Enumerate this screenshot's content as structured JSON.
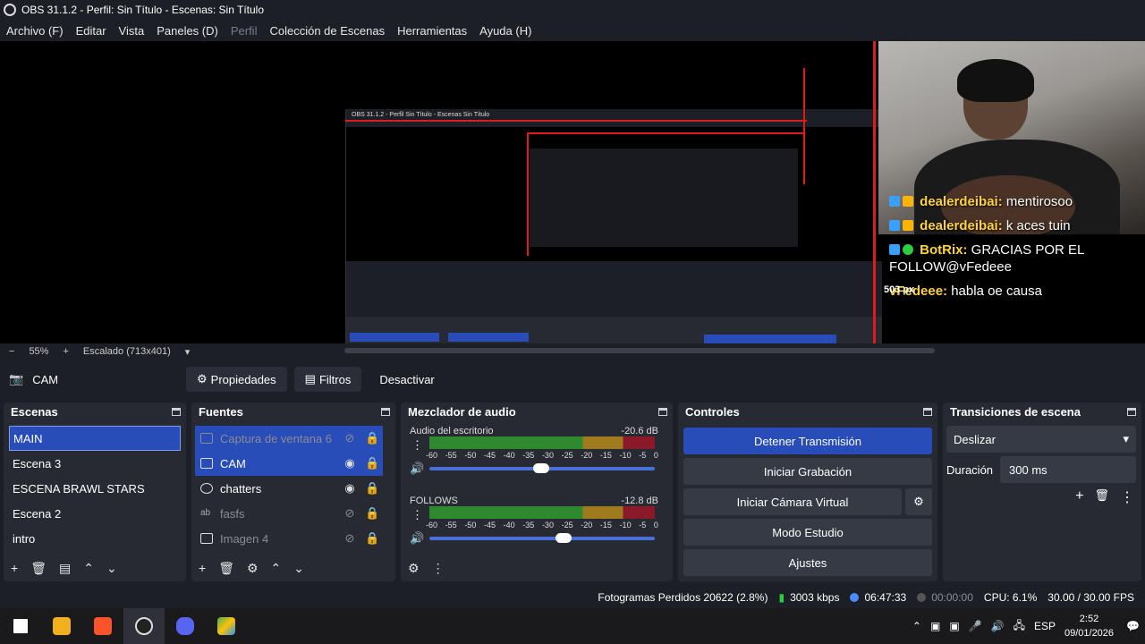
{
  "window": {
    "title": "OBS 31.1.2 - Perfil: Sin Título - Escenas: Sin Título"
  },
  "menu": {
    "items": [
      "Archivo (F)",
      "Editar",
      "Vista",
      "Paneles (D)",
      "Perfil",
      "Colección de Escenas",
      "Herramientas",
      "Ayuda (H)"
    ]
  },
  "preview": {
    "nested_title": "OBS 31.1.2 - Perfil Sin Título - Escenas Sin Título",
    "overlay_px": "503 px",
    "chat": [
      {
        "user": "dealerdeibai:",
        "message": "mentirosoo",
        "color": "#ffd23f"
      },
      {
        "user": "dealerdeibai:",
        "message": "k aces tuin",
        "color": "#ffd23f"
      },
      {
        "user": "BotRix:",
        "message": "GRACIAS POR EL FOLLOW@vFedeee",
        "color": "#ffd23f"
      },
      {
        "user": "vFedeee:",
        "message": "habla oe causa",
        "color": "#ffd23f"
      }
    ]
  },
  "zoombar": {
    "minus": "−",
    "zoom": "55%",
    "plus": "+",
    "scale": "Escalado (713x401)",
    "dropdown": "▾"
  },
  "source_toolbar": {
    "source_name": "CAM",
    "properties": "Propiedades",
    "filters": "Filtros",
    "deactivate": "Desactivar"
  },
  "scenes": {
    "title": "Escenas",
    "items": [
      "MAIN",
      "Escena 3",
      "ESCENA BRAWL STARS",
      "Escena 2",
      "intro"
    ]
  },
  "sources": {
    "title": "Fuentes",
    "items": [
      {
        "name": "Captura de ventana 6",
        "visible": false
      },
      {
        "name": "CAM",
        "visible": true
      },
      {
        "name": "chatters",
        "visible": true
      },
      {
        "name": "fasfs",
        "visible": false
      },
      {
        "name": "Imagen 4",
        "visible": false
      }
    ]
  },
  "mixer": {
    "title": "Mezclador de audio",
    "tracks": [
      {
        "name": "Audio del escritorio",
        "db": "-20.6 dB",
        "volume": 0.46
      },
      {
        "name": "FOLLOWS",
        "db": "-12.8 dB",
        "volume": 0.56
      }
    ],
    "ticks": [
      "-60",
      "-55",
      "-50",
      "-45",
      "-40",
      "-35",
      "-30",
      "-25",
      "-20",
      "-15",
      "-10",
      "-5",
      "0"
    ]
  },
  "controls": {
    "title": "Controles",
    "stop_stream": "Detener Transmisión",
    "start_recording": "Iniciar Grabación",
    "start_vcam": "Iniciar Cámara Virtual",
    "studio_mode": "Modo Estudio",
    "settings": "Ajustes"
  },
  "transitions": {
    "title": "Transiciones de escena",
    "selected": "Deslizar",
    "duration_label": "Duración",
    "duration_value": "300 ms"
  },
  "status": {
    "dropped": "Fotogramas Perdidos 20622 (2.8%)",
    "bitrate": "3003 kbps",
    "stream_time": "06:47:33",
    "rec_time": "00:00:00",
    "cpu": "CPU: 6.1%",
    "fps": "30.00 / 30.00 FPS"
  },
  "taskbar": {
    "lang": "ESP",
    "time": "2:52",
    "date": "09/01/2026"
  },
  "colors": {
    "accent": "#284cb8",
    "panel": "#272a33",
    "bg": "#1d1f26",
    "live": "#4a8bff"
  }
}
